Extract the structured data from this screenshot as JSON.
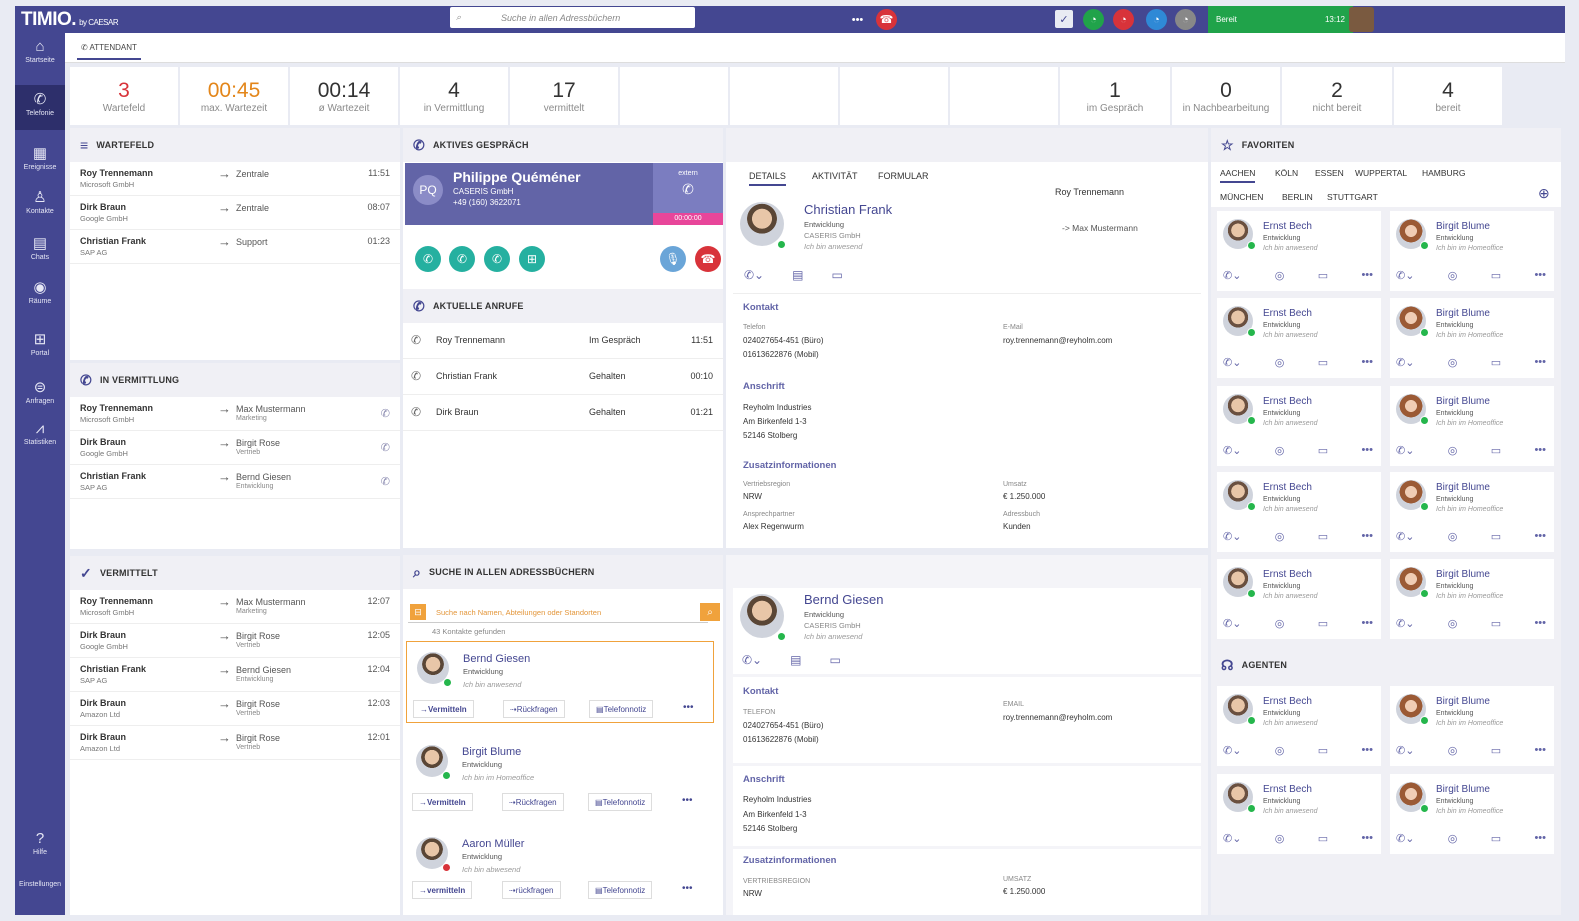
{
  "brand": {
    "name": "TIMIO.",
    "by": "by CAESAR"
  },
  "topbar": {
    "search_placeholder": "Suche in allen Adressbüchern",
    "status": "Bereit",
    "time": "13:12"
  },
  "nav": [
    {
      "label": "Startseite",
      "icon": "⌂"
    },
    {
      "label": "Telefonie",
      "icon": "✆"
    },
    {
      "label": "Ereignisse",
      "icon": "▦"
    },
    {
      "label": "Kontakte",
      "icon": "♙"
    },
    {
      "label": "Chats",
      "icon": "▤"
    },
    {
      "label": "Räume",
      "icon": "◉"
    },
    {
      "label": "Portal",
      "icon": "⊞"
    },
    {
      "label": "Anfragen",
      "icon": "⊜"
    },
    {
      "label": "Statistiken",
      "icon": "⩘"
    },
    {
      "label": "Hilfe",
      "icon": "?"
    },
    {
      "label": "Einstellungen",
      "icon": ""
    }
  ],
  "tab": "ATTENDANT",
  "stats": [
    {
      "value": "3",
      "label": "Wartefeld",
      "color": "#d8333a"
    },
    {
      "value": "00:45",
      "label": "max. Wartezeit",
      "color": "#e3861a"
    },
    {
      "value": "00:14",
      "label": "ø Wartezeit",
      "color": "#333"
    },
    {
      "value": "4",
      "label": "in Vermittlung",
      "color": "#333"
    },
    {
      "value": "17",
      "label": "vermittelt",
      "color": "#333"
    },
    {
      "value": "",
      "label": "",
      "color": "#333"
    },
    {
      "value": "",
      "label": "",
      "color": "#333"
    },
    {
      "value": "",
      "label": "",
      "color": "#333"
    },
    {
      "value": "",
      "label": "",
      "color": "#333"
    },
    {
      "value": "1",
      "label": "im Gespräch",
      "color": "#333"
    },
    {
      "value": "0",
      "label": "in Nachbearbeitung",
      "color": "#333"
    },
    {
      "value": "2",
      "label": "nicht bereit",
      "color": "#333"
    },
    {
      "value": "4",
      "label": "bereit",
      "color": "#333"
    }
  ],
  "wartefeld": {
    "title": "WARTEFELD",
    "rows": [
      {
        "name": "Roy Trennemann",
        "company": "Microsoft GmbH",
        "target": "Zentrale",
        "time": "11:51"
      },
      {
        "name": "Dirk Braun",
        "company": "Google GmbH",
        "target": "Zentrale",
        "time": "08:07"
      },
      {
        "name": "Christian Frank",
        "company": "SAP AG",
        "target": "Support",
        "time": "01:23"
      }
    ]
  },
  "invermittlung": {
    "title": "IN VERMITTLUNG",
    "rows": [
      {
        "name": "Roy Trennemann",
        "company": "Microsoft GmbH",
        "target": "Max Mustermann",
        "dept": "Marketing"
      },
      {
        "name": "Dirk Braun",
        "company": "Google GmbH",
        "target": "Birgit Rose",
        "dept": "Vertrieb"
      },
      {
        "name": "Christian Frank",
        "company": "SAP AG",
        "target": "Bernd Giesen",
        "dept": "Entwicklung"
      }
    ]
  },
  "vermittelt": {
    "title": "VERMITTELT",
    "rows": [
      {
        "name": "Roy Trennemann",
        "company": "Microsoft GmbH",
        "target": "Max Mustermann",
        "dept": "Marketing",
        "time": "12:07"
      },
      {
        "name": "Dirk Braun",
        "company": "Google GmbH",
        "target": "Birgit Rose",
        "dept": "Vertrieb",
        "time": "12:05"
      },
      {
        "name": "Christian Frank",
        "company": "SAP AG",
        "target": "Bernd Giesen",
        "dept": "Entwicklung",
        "time": "12:04"
      },
      {
        "name": "Dirk Braun",
        "company": "Amazon Ltd",
        "target": "Birgit Rose",
        "dept": "Vertrieb",
        "time": "12:03"
      },
      {
        "name": "Dirk Braun",
        "company": "Amazon Ltd",
        "target": "Birgit Rose",
        "dept": "Vertrieb",
        "time": "12:01"
      }
    ]
  },
  "aktiv": {
    "title": "AKTIVES GESPRÄCH",
    "initials": "PQ",
    "name": "Philippe Quéméner",
    "company": "CASERIS GmbH",
    "number": "+49 (160) 3622071",
    "extern": "extern",
    "timer": "00:00:00"
  },
  "aktuelle": {
    "title": "AKTUELLE ANRUFE",
    "rows": [
      {
        "name": "Roy Trennemann",
        "status": "Im Gespräch",
        "time": "11:51"
      },
      {
        "name": "Christian Frank",
        "status": "Gehalten",
        "time": "00:10"
      },
      {
        "name": "Dirk Braun",
        "status": "Gehalten",
        "time": "01:21"
      }
    ]
  },
  "suche": {
    "title": "SUCHE IN ALLEN ADRESSBÜCHERN",
    "placeholder": "Suche nach Namen, Abteilungen oder Standorten",
    "found": "43 Kontakte gefunden",
    "results": [
      {
        "name": "Bernd Giesen",
        "dept": "Entwicklung",
        "status": "Ich bin anwesend",
        "a1": "Vermitteln",
        "a2": "Rückfragen",
        "a3": "Telefonnotiz"
      },
      {
        "name": "Birgit Blume",
        "dept": "Entwicklung",
        "status": "Ich bin im Homeoffice",
        "a1": "Vermitteln",
        "a2": "Rückfragen",
        "a3": "Telefonnotiz"
      },
      {
        "name": "Aaron Müller",
        "dept": "Entwicklung",
        "status": "Ich bin abwesend",
        "a1": "vermitteln",
        "a2": "rückfragen",
        "a3": "Telefonnotiz"
      }
    ]
  },
  "details": {
    "tabs": [
      "DETAILS",
      "AKTIVITÄT",
      "FORMULAR"
    ],
    "caller": "Roy Trennemann",
    "forward": "-> Max Mustermann",
    "p1": {
      "name": "Christian Frank",
      "dept": "Entwicklung",
      "company": "CASERIS GmbH",
      "status": "Ich bin anwesend"
    },
    "kontakt": "Kontakt",
    "telefon_l": "Telefon",
    "tel1": "024027654-451 (Büro)",
    "tel2": "01613622876 (Mobil)",
    "email_l": "E-Mail",
    "email": "roy.trennemann@reyholm.com",
    "anschrift": "Anschrift",
    "addr1": "Reyholm Industries",
    "addr2": "Am Birkenfeld 1-3",
    "addr3": "52146 Stolberg",
    "zusatz": "Zusatzinformationen",
    "vr_l": "Vertriebsregion",
    "vr": "NRW",
    "ums_l": "Umsatz",
    "ums": "€ 1.250.000",
    "ap_l": "Ansprechpartner",
    "ap": "Alex Regenwurm",
    "ab_l": "Adressbuch",
    "ab": "Kunden",
    "p2": {
      "name": "Bernd Giesen",
      "dept": "Entwicklung",
      "company": "CASERIS GmbH",
      "status": "Ich bin anwesend"
    },
    "kontakt2": "Kontakt",
    "telefon_l2": "TELEFON",
    "email_l2": "EMAIL",
    "vr_l2": "VERTRIEBSREGION",
    "ums_l2": "UMSATZ"
  },
  "favoriten": {
    "title": "FAVORITEN",
    "tabs": [
      "AACHEN",
      "KÖLN",
      "ESSEN",
      "WUPPERTAL",
      "HAMBURG",
      "MÜNCHEN",
      "BERLIN",
      "STUTTGART"
    ],
    "left": {
      "name": "Ernst Bech",
      "dept": "Entwicklung",
      "status": "Ich bin anwesend"
    },
    "right": {
      "name": "Birgit Blume",
      "dept": "Entwicklung",
      "status": "Ich bin im Homeoffice"
    }
  },
  "agenten": {
    "title": "AGENTEN"
  }
}
